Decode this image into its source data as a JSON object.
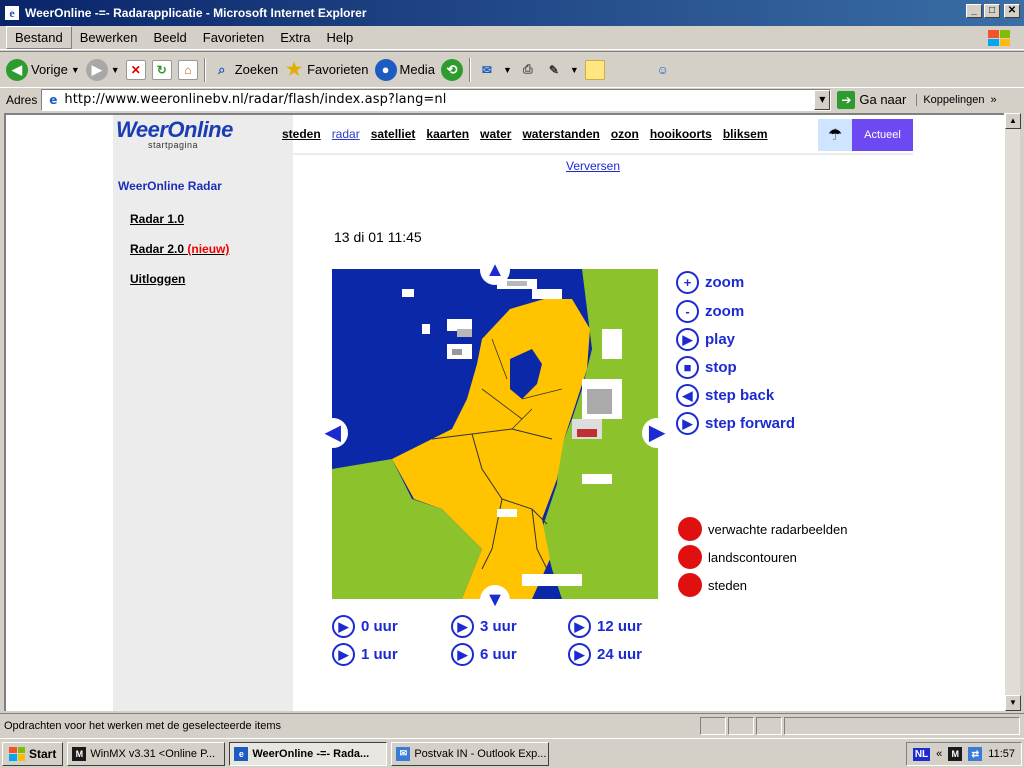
{
  "window": {
    "title": "WeerOnline -=- Radarapplicatie - Microsoft Internet Explorer",
    "app_icon": "ie-icon",
    "buttons": {
      "minimize": "_",
      "maximize": "□",
      "close": "✕"
    }
  },
  "menu": [
    "Bestand",
    "Bewerken",
    "Beeld",
    "Favorieten",
    "Extra",
    "Help"
  ],
  "toolbar": {
    "back": "Vorige",
    "search": "Zoeken",
    "favorites": "Favorieten",
    "media": "Media"
  },
  "address": {
    "label": "Adres",
    "value": "http://www.weeronlinebv.nl/radar/flash/index.asp?lang=nl",
    "go": "Ga naar",
    "links": "Koppelingen",
    "more": "»"
  },
  "page": {
    "logo": {
      "word": "WeerOnline",
      "sub": "startpagina"
    },
    "topnav": [
      {
        "label": "steden",
        "active": false
      },
      {
        "label": "radar",
        "active": true
      },
      {
        "label": "satelliet",
        "active": false
      },
      {
        "label": "kaarten",
        "active": false
      },
      {
        "label": "water",
        "active": false
      },
      {
        "label": "waterstanden",
        "active": false
      },
      {
        "label": "ozon",
        "active": false
      },
      {
        "label": "hooikoorts",
        "active": false
      },
      {
        "label": "bliksem",
        "active": false
      }
    ],
    "actuel": "Actueel",
    "sidebar": {
      "title": "WeerOnline Radar",
      "links": [
        {
          "label": "Radar 1.0",
          "badge": ""
        },
        {
          "label": "Radar 2.0",
          "badge": "(nieuw)"
        },
        {
          "label": "Uitloggen",
          "badge": ""
        }
      ]
    },
    "refresh": "Verversen",
    "timestamp": "13 di 01 11:45",
    "map": {
      "sea_color": "#0a28a8",
      "land_color": "#ffc300",
      "neighbour_color": "#8cc22c",
      "arrows": [
        "up",
        "down",
        "left",
        "right"
      ]
    },
    "controls": [
      {
        "icon": "+",
        "label": "zoom"
      },
      {
        "icon": "-",
        "label": "zoom"
      },
      {
        "icon": "▶",
        "label": "play"
      },
      {
        "icon": "■",
        "label": "stop"
      },
      {
        "icon": "◀",
        "label": "step back"
      },
      {
        "icon": "▶",
        "label": "step forward"
      }
    ],
    "toggles": [
      "verwachte radarbeelden",
      "landscontouren",
      "steden"
    ],
    "hours": [
      "0 uur",
      "1 uur",
      "3 uur",
      "6 uur",
      "12 uur",
      "24 uur"
    ]
  },
  "status": {
    "text": "Opdrachten voor het werken met de geselecteerde items"
  },
  "taskbar": {
    "start": "Start",
    "tasks": [
      {
        "label": "WinMX v3.31  <Online P...",
        "active": false
      },
      {
        "label": "WeerOnline -=- Rada...",
        "active": true
      },
      {
        "label": "Postvak IN - Outlook Exp...",
        "active": false
      }
    ],
    "tray": {
      "lang": "NL",
      "time": "11:57"
    }
  }
}
